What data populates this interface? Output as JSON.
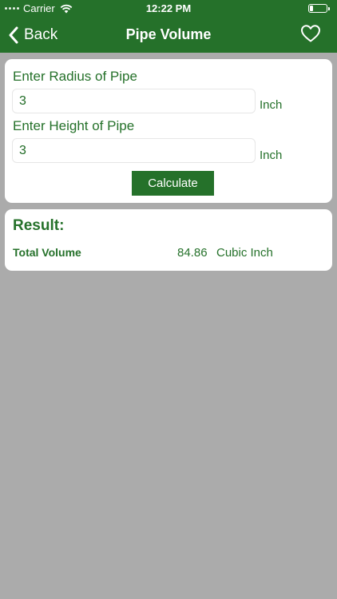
{
  "status_bar": {
    "carrier": "Carrier",
    "time": "12:22 PM"
  },
  "nav": {
    "back_label": "Back",
    "title": "Pipe Volume"
  },
  "inputs": {
    "radius_label": "Enter Radius of Pipe",
    "radius_value": "3",
    "radius_unit": "Inch",
    "height_label": "Enter Height of Pipe",
    "height_value": "3",
    "height_unit": "Inch"
  },
  "calculate_label": "Calculate",
  "result": {
    "title": "Result:",
    "label": "Total Volume",
    "value": "84.86",
    "unit": "Cubic Inch"
  },
  "colors": {
    "primary": "#25712a",
    "background": "#ababab",
    "card": "#ffffff"
  },
  "icons": {
    "back": "chevron-left-icon",
    "favorite": "heart-outline-icon",
    "wifi": "wifi-icon",
    "battery": "battery-icon"
  }
}
